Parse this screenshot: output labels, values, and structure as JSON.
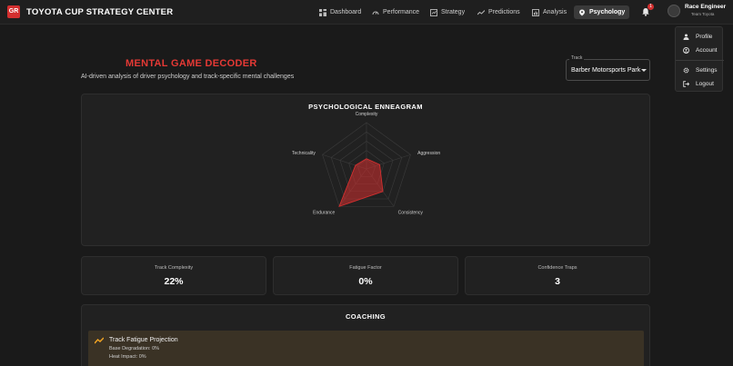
{
  "brand": {
    "logo_text": "GR",
    "title": "TOYOTA CUP STRATEGY CENTER"
  },
  "nav": {
    "items": [
      {
        "label": "Dashboard",
        "icon": "dashboard-icon"
      },
      {
        "label": "Performance",
        "icon": "speedometer-icon"
      },
      {
        "label": "Strategy",
        "icon": "strategy-icon"
      },
      {
        "label": "Predictions",
        "icon": "trend-icon"
      },
      {
        "label": "Analysis",
        "icon": "analysis-icon"
      },
      {
        "label": "Psychology",
        "icon": "psychology-icon",
        "active": true
      }
    ]
  },
  "notifications": {
    "count": "1"
  },
  "user": {
    "name": "Race Engineer",
    "role": "Team Toyota",
    "menu": [
      {
        "label": "Profile",
        "icon": "person-icon"
      },
      {
        "label": "Account",
        "icon": "account-icon"
      },
      {
        "label": "Settings",
        "icon": "gear-icon"
      },
      {
        "label": "Logout",
        "icon": "logout-icon"
      }
    ]
  },
  "page": {
    "title": "MENTAL GAME DECODER",
    "subtitle": "AI-driven analysis of driver psychology and track-specific mental challenges"
  },
  "track_select": {
    "legend": "Track",
    "value": "Barber Motorsports Park"
  },
  "enneagram": {
    "heading": "PSYCHOLOGICAL ENNEAGRAM",
    "axes": [
      "Complexity",
      "Aggression",
      "Consistency",
      "Endurance",
      "Technicality"
    ],
    "values": [
      0.22,
      0.3,
      0.6,
      1.0,
      0.25
    ],
    "scale_levels": 5,
    "fill_color": "#d32f2f"
  },
  "metrics": [
    {
      "label": "Track Complexity",
      "value": "22%"
    },
    {
      "label": "Fatigue Factor",
      "value": "0%"
    },
    {
      "label": "Confidence Traps",
      "value": "3"
    }
  ],
  "coaching": {
    "heading": "COACHING",
    "item": {
      "title": "Track Fatigue Projection",
      "lines": [
        "Base Degradation: 0%",
        "Heat Impact: 0%"
      ],
      "accent": "#f5a623"
    }
  }
}
